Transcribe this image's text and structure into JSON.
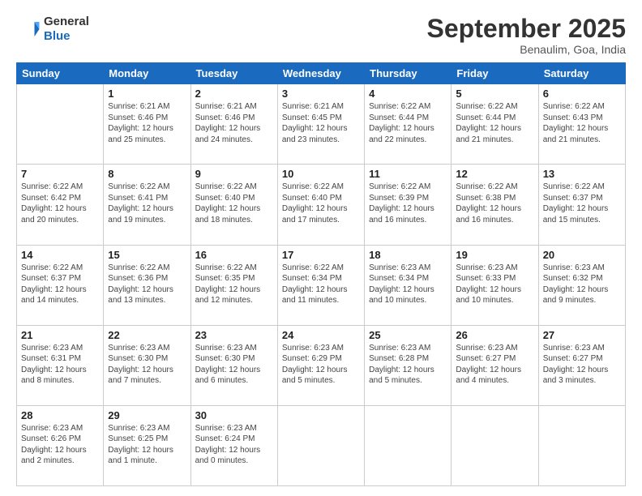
{
  "header": {
    "logo_general": "General",
    "logo_blue": "Blue",
    "month": "September 2025",
    "location": "Benaulim, Goa, India"
  },
  "weekdays": [
    "Sunday",
    "Monday",
    "Tuesday",
    "Wednesday",
    "Thursday",
    "Friday",
    "Saturday"
  ],
  "weeks": [
    [
      {
        "day": "",
        "info": ""
      },
      {
        "day": "1",
        "info": "Sunrise: 6:21 AM\nSunset: 6:46 PM\nDaylight: 12 hours\nand 25 minutes."
      },
      {
        "day": "2",
        "info": "Sunrise: 6:21 AM\nSunset: 6:46 PM\nDaylight: 12 hours\nand 24 minutes."
      },
      {
        "day": "3",
        "info": "Sunrise: 6:21 AM\nSunset: 6:45 PM\nDaylight: 12 hours\nand 23 minutes."
      },
      {
        "day": "4",
        "info": "Sunrise: 6:22 AM\nSunset: 6:44 PM\nDaylight: 12 hours\nand 22 minutes."
      },
      {
        "day": "5",
        "info": "Sunrise: 6:22 AM\nSunset: 6:44 PM\nDaylight: 12 hours\nand 21 minutes."
      },
      {
        "day": "6",
        "info": "Sunrise: 6:22 AM\nSunset: 6:43 PM\nDaylight: 12 hours\nand 21 minutes."
      }
    ],
    [
      {
        "day": "7",
        "info": "Sunrise: 6:22 AM\nSunset: 6:42 PM\nDaylight: 12 hours\nand 20 minutes."
      },
      {
        "day": "8",
        "info": "Sunrise: 6:22 AM\nSunset: 6:41 PM\nDaylight: 12 hours\nand 19 minutes."
      },
      {
        "day": "9",
        "info": "Sunrise: 6:22 AM\nSunset: 6:40 PM\nDaylight: 12 hours\nand 18 minutes."
      },
      {
        "day": "10",
        "info": "Sunrise: 6:22 AM\nSunset: 6:40 PM\nDaylight: 12 hours\nand 17 minutes."
      },
      {
        "day": "11",
        "info": "Sunrise: 6:22 AM\nSunset: 6:39 PM\nDaylight: 12 hours\nand 16 minutes."
      },
      {
        "day": "12",
        "info": "Sunrise: 6:22 AM\nSunset: 6:38 PM\nDaylight: 12 hours\nand 16 minutes."
      },
      {
        "day": "13",
        "info": "Sunrise: 6:22 AM\nSunset: 6:37 PM\nDaylight: 12 hours\nand 15 minutes."
      }
    ],
    [
      {
        "day": "14",
        "info": "Sunrise: 6:22 AM\nSunset: 6:37 PM\nDaylight: 12 hours\nand 14 minutes."
      },
      {
        "day": "15",
        "info": "Sunrise: 6:22 AM\nSunset: 6:36 PM\nDaylight: 12 hours\nand 13 minutes."
      },
      {
        "day": "16",
        "info": "Sunrise: 6:22 AM\nSunset: 6:35 PM\nDaylight: 12 hours\nand 12 minutes."
      },
      {
        "day": "17",
        "info": "Sunrise: 6:22 AM\nSunset: 6:34 PM\nDaylight: 12 hours\nand 11 minutes."
      },
      {
        "day": "18",
        "info": "Sunrise: 6:23 AM\nSunset: 6:34 PM\nDaylight: 12 hours\nand 10 minutes."
      },
      {
        "day": "19",
        "info": "Sunrise: 6:23 AM\nSunset: 6:33 PM\nDaylight: 12 hours\nand 10 minutes."
      },
      {
        "day": "20",
        "info": "Sunrise: 6:23 AM\nSunset: 6:32 PM\nDaylight: 12 hours\nand 9 minutes."
      }
    ],
    [
      {
        "day": "21",
        "info": "Sunrise: 6:23 AM\nSunset: 6:31 PM\nDaylight: 12 hours\nand 8 minutes."
      },
      {
        "day": "22",
        "info": "Sunrise: 6:23 AM\nSunset: 6:30 PM\nDaylight: 12 hours\nand 7 minutes."
      },
      {
        "day": "23",
        "info": "Sunrise: 6:23 AM\nSunset: 6:30 PM\nDaylight: 12 hours\nand 6 minutes."
      },
      {
        "day": "24",
        "info": "Sunrise: 6:23 AM\nSunset: 6:29 PM\nDaylight: 12 hours\nand 5 minutes."
      },
      {
        "day": "25",
        "info": "Sunrise: 6:23 AM\nSunset: 6:28 PM\nDaylight: 12 hours\nand 5 minutes."
      },
      {
        "day": "26",
        "info": "Sunrise: 6:23 AM\nSunset: 6:27 PM\nDaylight: 12 hours\nand 4 minutes."
      },
      {
        "day": "27",
        "info": "Sunrise: 6:23 AM\nSunset: 6:27 PM\nDaylight: 12 hours\nand 3 minutes."
      }
    ],
    [
      {
        "day": "28",
        "info": "Sunrise: 6:23 AM\nSunset: 6:26 PM\nDaylight: 12 hours\nand 2 minutes."
      },
      {
        "day": "29",
        "info": "Sunrise: 6:23 AM\nSunset: 6:25 PM\nDaylight: 12 hours\nand 1 minute."
      },
      {
        "day": "30",
        "info": "Sunrise: 6:23 AM\nSunset: 6:24 PM\nDaylight: 12 hours\nand 0 minutes."
      },
      {
        "day": "",
        "info": ""
      },
      {
        "day": "",
        "info": ""
      },
      {
        "day": "",
        "info": ""
      },
      {
        "day": "",
        "info": ""
      }
    ]
  ]
}
